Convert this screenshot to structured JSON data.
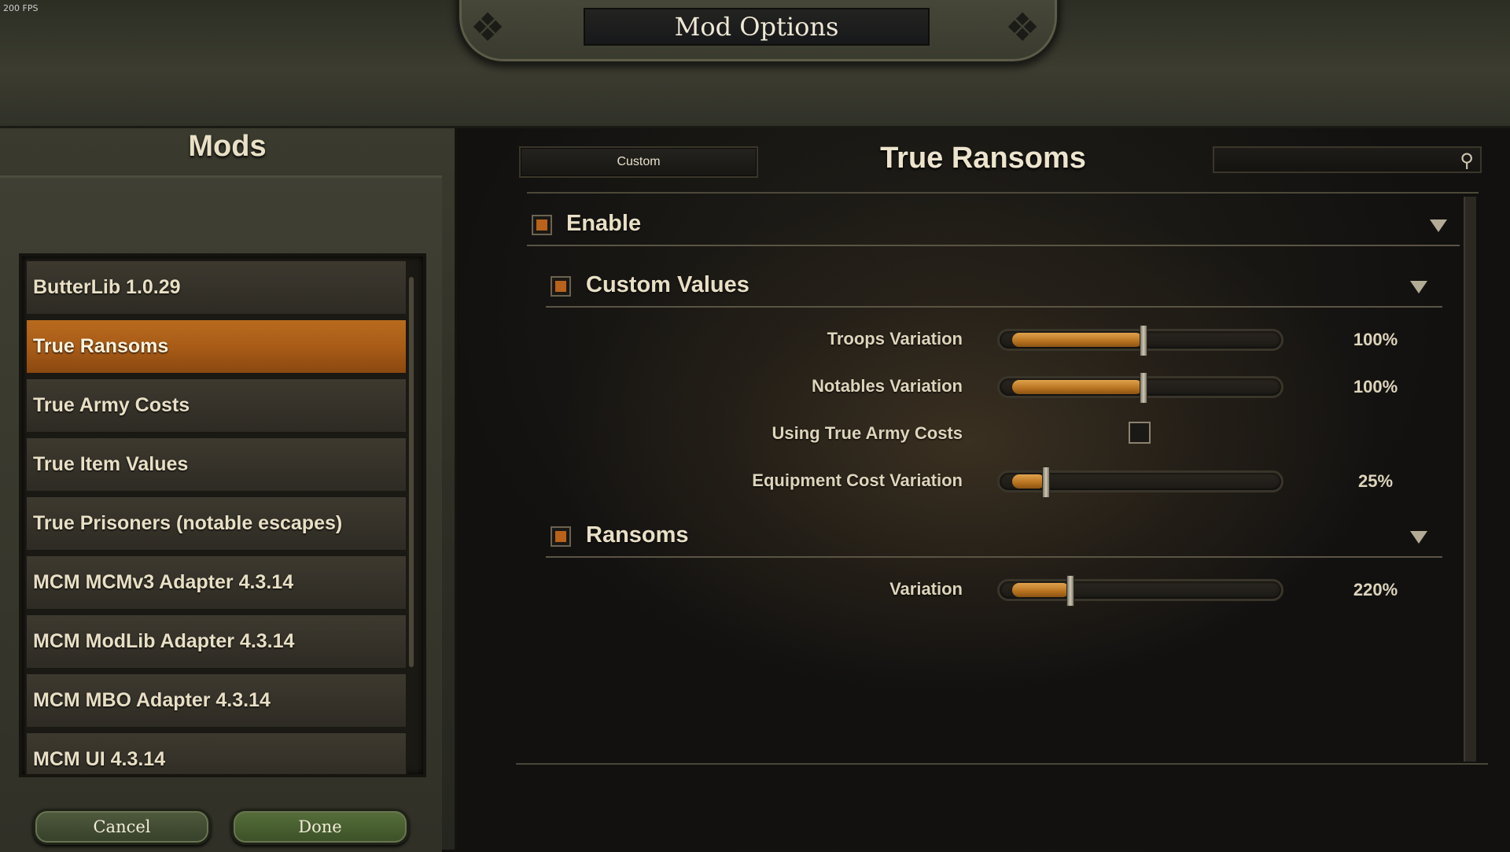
{
  "fps": "200 FPS",
  "window_title": "Mod Options",
  "left_panel": {
    "title": "Mods",
    "mods": [
      {
        "label": "ButterLib 1.0.29",
        "selected": false
      },
      {
        "label": "True Ransoms",
        "selected": true
      },
      {
        "label": "True Army Costs",
        "selected": false
      },
      {
        "label": "True Item Values",
        "selected": false
      },
      {
        "label": "True Prisoners (notable escapes)",
        "selected": false
      },
      {
        "label": "MCM MCMv3 Adapter 4.3.14",
        "selected": false
      },
      {
        "label": "MCM ModLib Adapter 4.3.14",
        "selected": false
      },
      {
        "label": "MCM MBO Adapter 4.3.14",
        "selected": false
      },
      {
        "label": "MCM UI 4.3.14",
        "selected": false
      }
    ],
    "cancel_label": "Cancel",
    "done_label": "Done"
  },
  "right_panel": {
    "preset_label": "Custom",
    "mod_title": "True Ransoms",
    "search_placeholder": "",
    "groups": {
      "enable": {
        "label": "Enable",
        "checked": true
      },
      "custom_values": {
        "label": "Custom Values",
        "checked": true
      },
      "ransoms": {
        "label": "Ransoms",
        "checked": true
      }
    },
    "settings": {
      "troops_variation": {
        "label": "Troops Variation",
        "value_text": "100%",
        "fill_fraction": 0.5
      },
      "notables_variation": {
        "label": "Notables Variation",
        "value_text": "100%",
        "fill_fraction": 0.5
      },
      "using_true_army_costs": {
        "label": "Using True Army Costs",
        "checked": false
      },
      "equipment_cost_variation": {
        "label": "Equipment Cost Variation",
        "value_text": "25%",
        "fill_fraction": 0.125
      },
      "variation": {
        "label": "Variation",
        "value_text": "220%",
        "fill_fraction": 0.22
      }
    }
  },
  "colors": {
    "accent_orange": "#b8621c",
    "selected_row": "#a95c17",
    "text_light": "#e8dfc5"
  }
}
